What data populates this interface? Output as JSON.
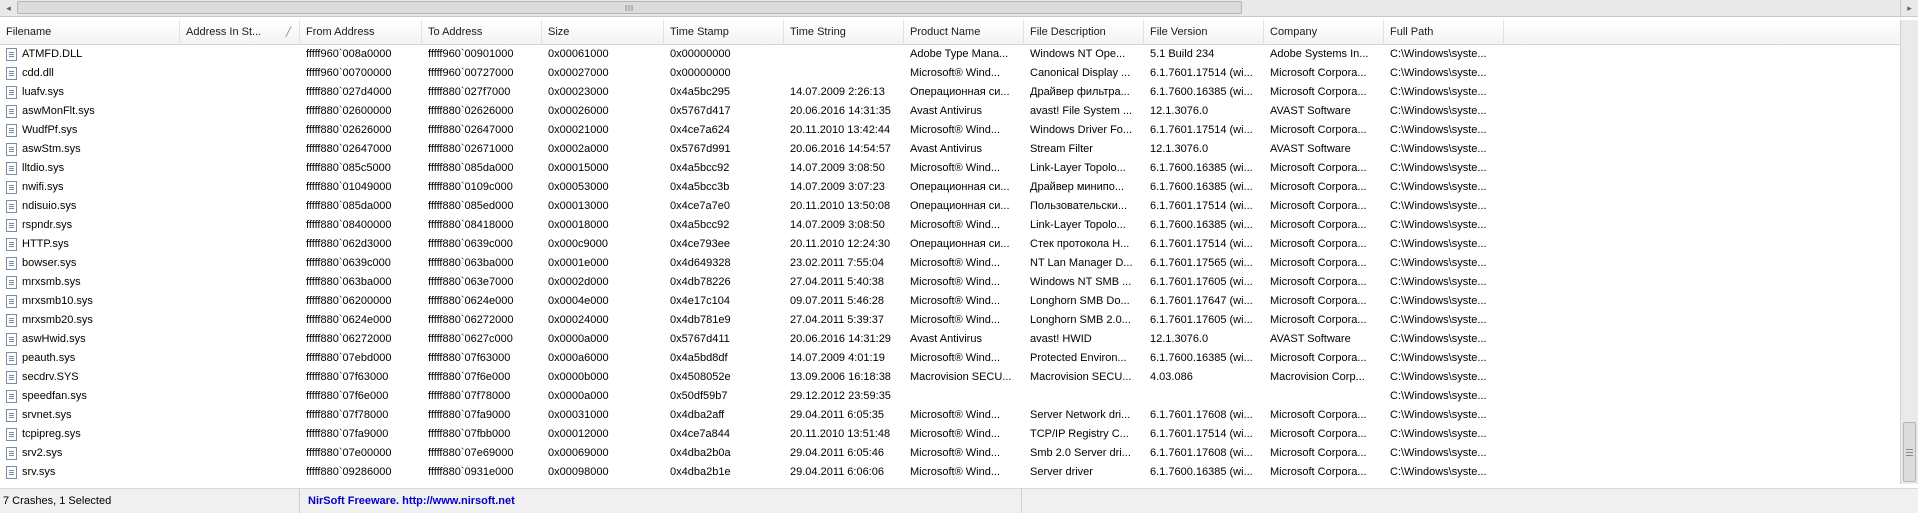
{
  "columns": [
    "Filename",
    "Address In St...",
    "From Address",
    "To Address",
    "Size",
    "Time Stamp",
    "Time String",
    "Product Name",
    "File Description",
    "File Version",
    "Company",
    "Full Path"
  ],
  "rows": [
    [
      "ATMFD.DLL",
      "",
      "fffff960`008a0000",
      "fffff960`00901000",
      "0x00061000",
      "0x00000000",
      "",
      "Adobe Type Mana...",
      "Windows NT Ope...",
      "5.1 Build 234",
      "Adobe Systems In...",
      "C:\\Windows\\syste..."
    ],
    [
      "cdd.dll",
      "",
      "fffff960`00700000",
      "fffff960`00727000",
      "0x00027000",
      "0x00000000",
      "",
      "Microsoft® Wind...",
      "Canonical Display ...",
      "6.1.7601.17514 (wi...",
      "Microsoft Corpora...",
      "C:\\Windows\\syste..."
    ],
    [
      "luafv.sys",
      "",
      "fffff880`027d4000",
      "fffff880`027f7000",
      "0x00023000",
      "0x4a5bc295",
      "14.07.2009 2:26:13",
      "Операционная си...",
      "Драйвер фильтра...",
      "6.1.7600.16385 (wi...",
      "Microsoft Corpora...",
      "C:\\Windows\\syste..."
    ],
    [
      "aswMonFlt.sys",
      "",
      "fffff880`02600000",
      "fffff880`02626000",
      "0x00026000",
      "0x5767d417",
      "20.06.2016 14:31:35",
      "Avast Antivirus",
      "avast! File System ...",
      "12.1.3076.0",
      "AVAST Software",
      "C:\\Windows\\syste..."
    ],
    [
      "WudfPf.sys",
      "",
      "fffff880`02626000",
      "fffff880`02647000",
      "0x00021000",
      "0x4ce7a624",
      "20.11.2010 13:42:44",
      "Microsoft® Wind...",
      "Windows Driver Fo...",
      "6.1.7601.17514 (wi...",
      "Microsoft Corpora...",
      "C:\\Windows\\syste..."
    ],
    [
      "aswStm.sys",
      "",
      "fffff880`02647000",
      "fffff880`02671000",
      "0x0002a000",
      "0x5767d991",
      "20.06.2016 14:54:57",
      "Avast Antivirus",
      "Stream Filter",
      "12.1.3076.0",
      "AVAST Software",
      "C:\\Windows\\syste..."
    ],
    [
      "lltdio.sys",
      "",
      "fffff880`085c5000",
      "fffff880`085da000",
      "0x00015000",
      "0x4a5bcc92",
      "14.07.2009 3:08:50",
      "Microsoft® Wind...",
      "Link-Layer Topolo...",
      "6.1.7600.16385 (wi...",
      "Microsoft Corpora...",
      "C:\\Windows\\syste..."
    ],
    [
      "nwifi.sys",
      "",
      "fffff880`01049000",
      "fffff880`0109c000",
      "0x00053000",
      "0x4a5bcc3b",
      "14.07.2009 3:07:23",
      "Операционная си...",
      "Драйвер минипо...",
      "6.1.7600.16385 (wi...",
      "Microsoft Corpora...",
      "C:\\Windows\\syste..."
    ],
    [
      "ndisuio.sys",
      "",
      "fffff880`085da000",
      "fffff880`085ed000",
      "0x00013000",
      "0x4ce7a7e0",
      "20.11.2010 13:50:08",
      "Операционная си...",
      "Пользовательски...",
      "6.1.7601.17514 (wi...",
      "Microsoft Corpora...",
      "C:\\Windows\\syste..."
    ],
    [
      "rspndr.sys",
      "",
      "fffff880`08400000",
      "fffff880`08418000",
      "0x00018000",
      "0x4a5bcc92",
      "14.07.2009 3:08:50",
      "Microsoft® Wind...",
      "Link-Layer Topolo...",
      "6.1.7600.16385 (wi...",
      "Microsoft Corpora...",
      "C:\\Windows\\syste..."
    ],
    [
      "HTTP.sys",
      "",
      "fffff880`062d3000",
      "fffff880`0639c000",
      "0x000c9000",
      "0x4ce793ee",
      "20.11.2010 12:24:30",
      "Операционная си...",
      "Стек протокола Н...",
      "6.1.7601.17514 (wi...",
      "Microsoft Corpora...",
      "C:\\Windows\\syste..."
    ],
    [
      "bowser.sys",
      "",
      "fffff880`0639c000",
      "fffff880`063ba000",
      "0x0001e000",
      "0x4d649328",
      "23.02.2011 7:55:04",
      "Microsoft® Wind...",
      "NT Lan Manager D...",
      "6.1.7601.17565 (wi...",
      "Microsoft Corpora...",
      "C:\\Windows\\syste..."
    ],
    [
      "mrxsmb.sys",
      "",
      "fffff880`063ba000",
      "fffff880`063e7000",
      "0x0002d000",
      "0x4db78226",
      "27.04.2011 5:40:38",
      "Microsoft® Wind...",
      "Windows NT SMB ...",
      "6.1.7601.17605 (wi...",
      "Microsoft Corpora...",
      "C:\\Windows\\syste..."
    ],
    [
      "mrxsmb10.sys",
      "",
      "fffff880`06200000",
      "fffff880`0624e000",
      "0x0004e000",
      "0x4e17c104",
      "09.07.2011 5:46:28",
      "Microsoft® Wind...",
      "Longhorn SMB Do...",
      "6.1.7601.17647 (wi...",
      "Microsoft Corpora...",
      "C:\\Windows\\syste..."
    ],
    [
      "mrxsmb20.sys",
      "",
      "fffff880`0624e000",
      "fffff880`06272000",
      "0x00024000",
      "0x4db781e9",
      "27.04.2011 5:39:37",
      "Microsoft® Wind...",
      "Longhorn SMB 2.0...",
      "6.1.7601.17605 (wi...",
      "Microsoft Corpora...",
      "C:\\Windows\\syste..."
    ],
    [
      "aswHwid.sys",
      "",
      "fffff880`06272000",
      "fffff880`0627c000",
      "0x0000a000",
      "0x5767d411",
      "20.06.2016 14:31:29",
      "Avast Antivirus",
      "avast! HWID",
      "12.1.3076.0",
      "AVAST Software",
      "C:\\Windows\\syste..."
    ],
    [
      "peauth.sys",
      "",
      "fffff880`07ebd000",
      "fffff880`07f63000",
      "0x000a6000",
      "0x4a5bd8df",
      "14.07.2009 4:01:19",
      "Microsoft® Wind...",
      "Protected Environ...",
      "6.1.7600.16385 (wi...",
      "Microsoft Corpora...",
      "C:\\Windows\\syste..."
    ],
    [
      "secdrv.SYS",
      "",
      "fffff880`07f63000",
      "fffff880`07f6e000",
      "0x0000b000",
      "0x4508052e",
      "13.09.2006 16:18:38",
      "Macrovision SECU...",
      "Macrovision SECU...",
      "4.03.086",
      "Macrovision Corp...",
      "C:\\Windows\\syste..."
    ],
    [
      "speedfan.sys",
      "",
      "fffff880`07f6e000",
      "fffff880`07f78000",
      "0x0000a000",
      "0x50df59b7",
      "29.12.2012 23:59:35",
      "",
      "",
      "",
      "",
      "C:\\Windows\\syste..."
    ],
    [
      "srvnet.sys",
      "",
      "fffff880`07f78000",
      "fffff880`07fa9000",
      "0x00031000",
      "0x4dba2aff",
      "29.04.2011 6:05:35",
      "Microsoft® Wind...",
      "Server Network dri...",
      "6.1.7601.17608 (wi...",
      "Microsoft Corpora...",
      "C:\\Windows\\syste..."
    ],
    [
      "tcpipreg.sys",
      "",
      "fffff880`07fa9000",
      "fffff880`07fbb000",
      "0x00012000",
      "0x4ce7a844",
      "20.11.2010 13:51:48",
      "Microsoft® Wind...",
      "TCP/IP Registry C...",
      "6.1.7601.17514 (wi...",
      "Microsoft Corpora...",
      "C:\\Windows\\syste..."
    ],
    [
      "srv2.sys",
      "",
      "fffff880`07e00000",
      "fffff880`07e69000",
      "0x00069000",
      "0x4dba2b0a",
      "29.04.2011 6:05:46",
      "Microsoft® Wind...",
      "Smb 2.0 Server dri...",
      "6.1.7601.17608 (wi...",
      "Microsoft Corpora...",
      "C:\\Windows\\syste..."
    ],
    [
      "srv.sys",
      "",
      "fffff880`09286000",
      "fffff880`0931e000",
      "0x00098000",
      "0x4dba2b1e",
      "29.04.2011 6:06:06",
      "Microsoft® Wind...",
      "Server driver",
      "6.1.7600.16385 (wi...",
      "Microsoft Corpora...",
      "C:\\Windows\\syste..."
    ]
  ],
  "status": {
    "summary": "7 Crashes, 1 Selected",
    "credit_link": "NirSoft Freeware.  http://www.nirsoft.net"
  },
  "icons": {
    "scroll_left": "arrow-left-icon",
    "scroll_right": "arrow-right-icon",
    "sort_indicator": "sort-ascending-icon",
    "file": "file-icon"
  }
}
